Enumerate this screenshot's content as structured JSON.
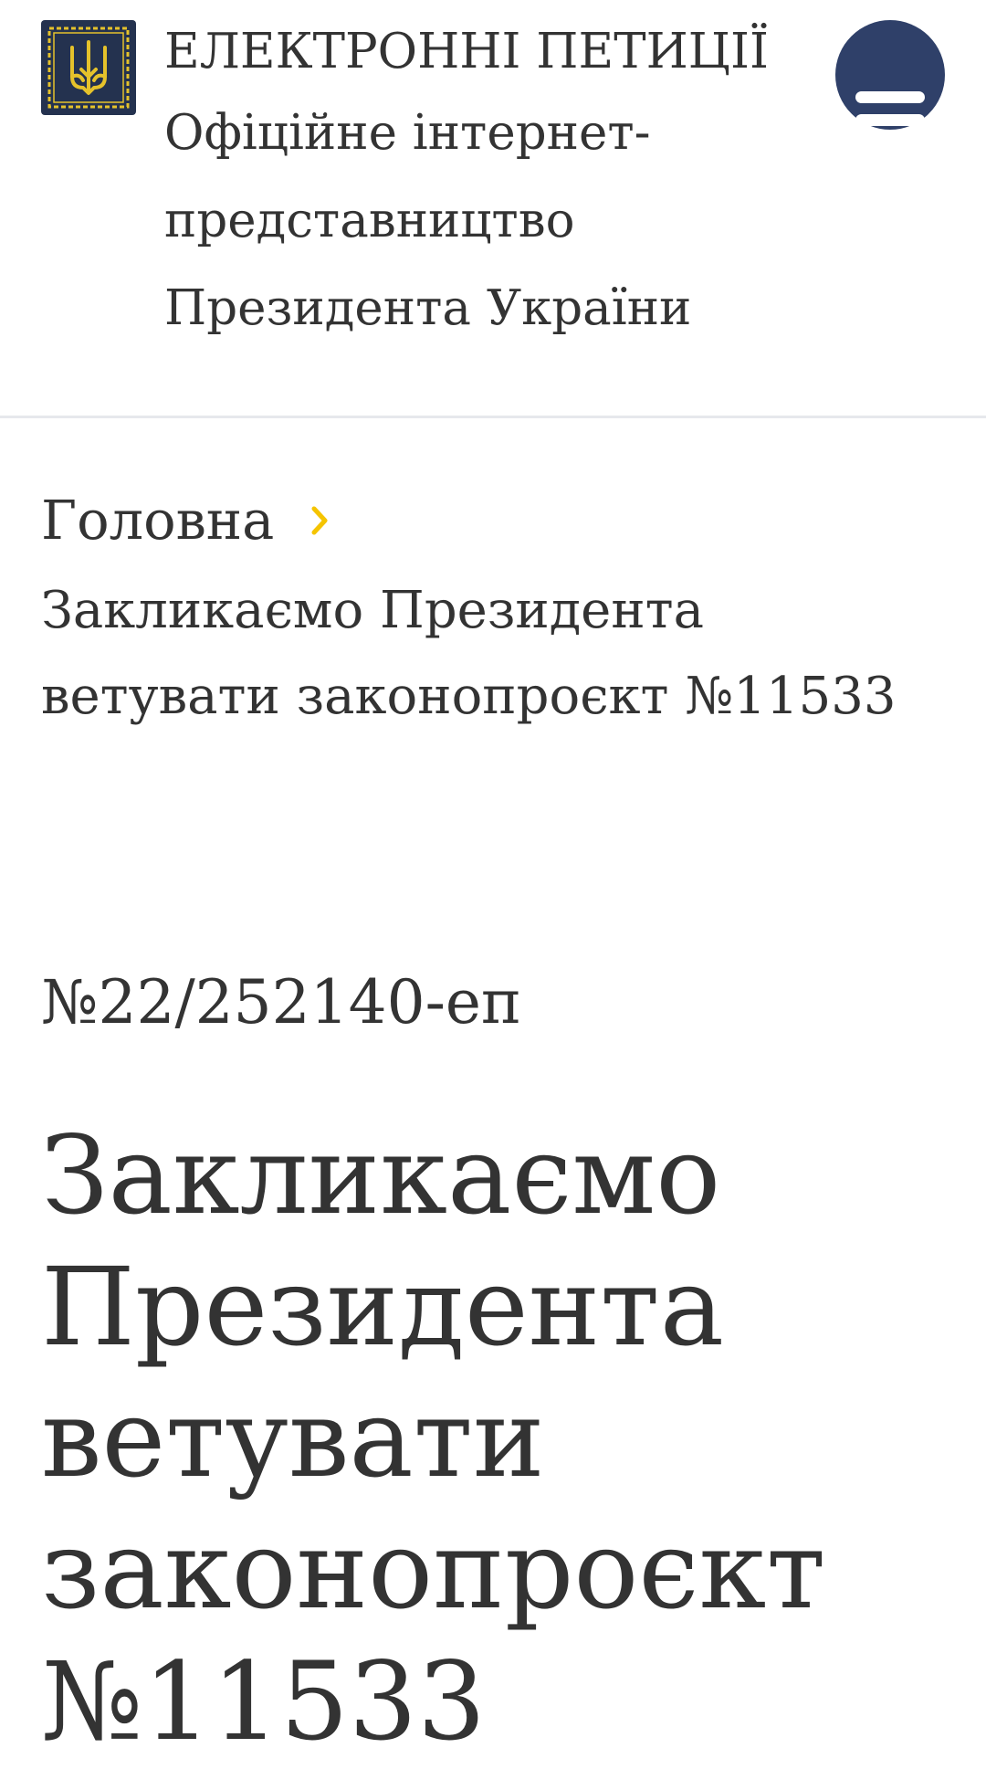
{
  "header": {
    "logo_icon": "trident-coat-of-arms-icon",
    "title_line1": "ЕЛЕКТРОННІ ПЕТИЦІЇ",
    "title_line2": "Офіційне інтернет-представництво Президента України",
    "menu_icon": "hamburger-menu-icon"
  },
  "breadcrumb": {
    "home_label": "Головна",
    "separator_icon": "chevron-right-icon",
    "current_label": "Закликаємо Президента ветувати законопроєкт №11533"
  },
  "petition": {
    "number": "№22/252140-еп",
    "title": "Закликаємо Президента ветувати законопроєкт №11533"
  },
  "colors": {
    "logo_bg": "#24324f",
    "logo_gold": "#e5c22b",
    "menu_bg": "#2f4069",
    "accent_chevron": "#f5c400",
    "text": "#333333"
  }
}
